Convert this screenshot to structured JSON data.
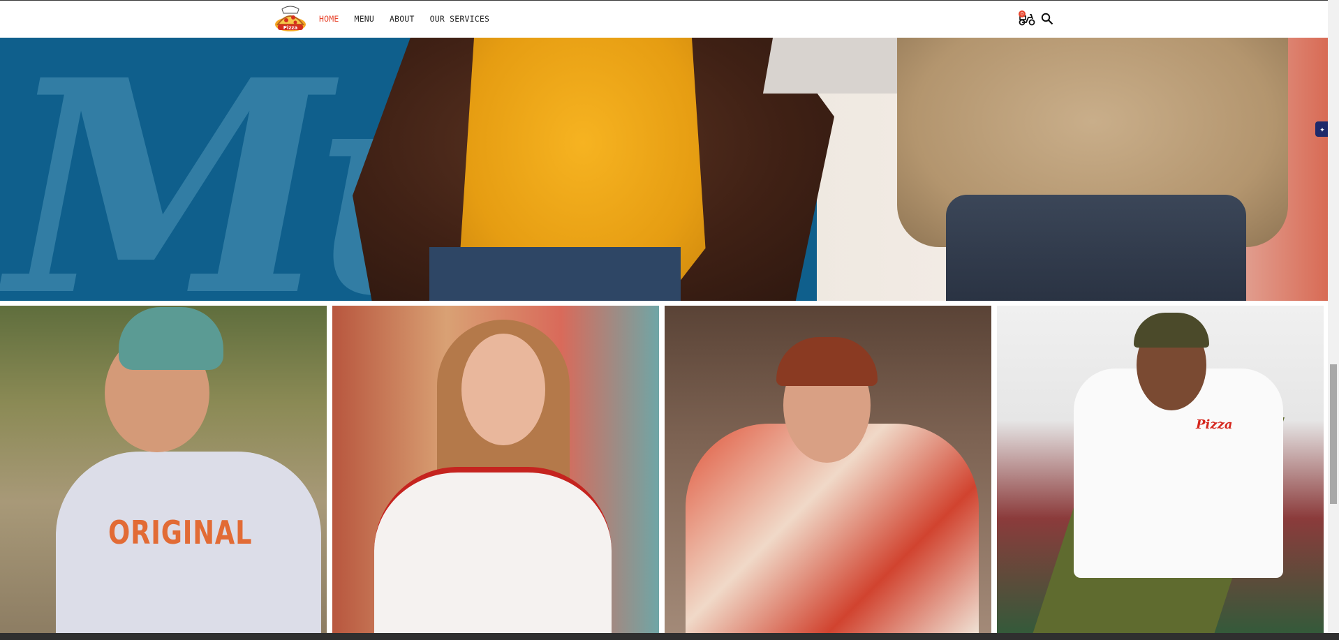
{
  "nav": {
    "logo_alt": "Pizza",
    "items": [
      {
        "label": "HOME",
        "active": true
      },
      {
        "label": "MENU",
        "active": false
      },
      {
        "label": "ABOUT",
        "active": false
      },
      {
        "label": "OUR SERVICES",
        "active": false
      }
    ],
    "cart_count": "0",
    "accent_color": "#e8442c"
  },
  "hero": {
    "background_text": "Mu"
  },
  "gallery": {
    "items": [
      {
        "shirt_text": "ORIGINAL"
      },
      {
        "shirt_text": ""
      },
      {
        "shirt_text": ""
      },
      {
        "shirt_text": "Pizza"
      }
    ]
  },
  "icons": {
    "cart": "scooter-cart-icon",
    "search": "search-icon",
    "side": "sparkle-icon"
  }
}
